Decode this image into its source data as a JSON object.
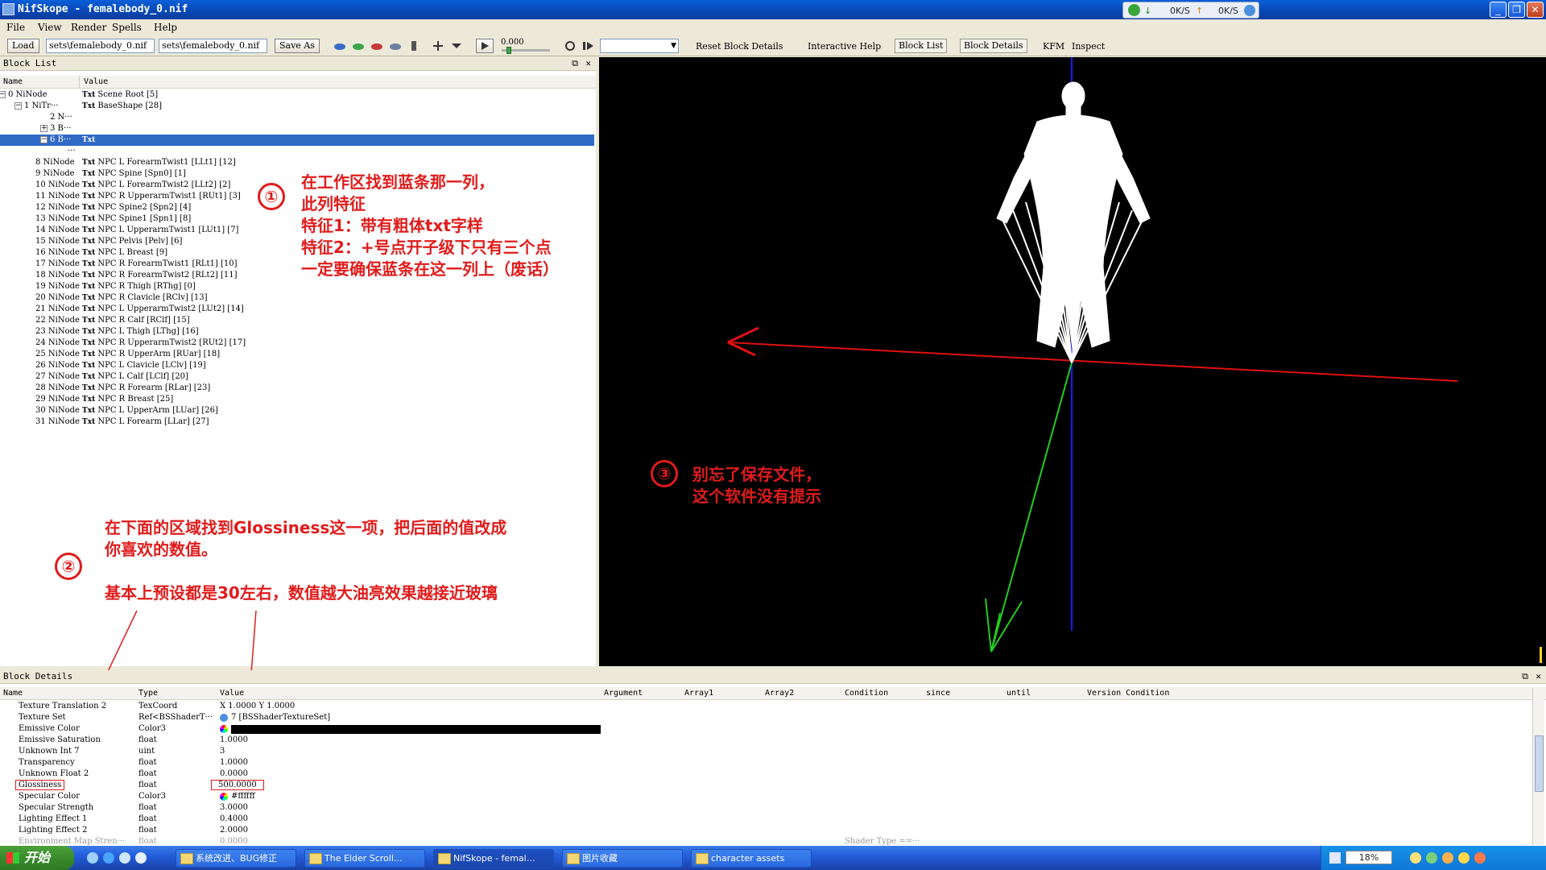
{
  "window": {
    "title": "NifSkope - femalebody_0.nif"
  },
  "netmeter": {
    "down": "0K/S",
    "up": "0K/S"
  },
  "menu": [
    "File",
    "View",
    "Render",
    "Spells",
    "Help"
  ],
  "toolbar": {
    "load": "Load",
    "path1": "sets\\femalebody_0.nif",
    "path2": "sets\\femalebody_0.nif",
    "save_as": "Save As",
    "time_value": "0.000",
    "reset_block_details": "Reset Block Details",
    "interactive_help": "Interactive Help",
    "block_list": "Block List",
    "block_details": "Block Details",
    "kfm": "KFM",
    "inspect": "Inspect"
  },
  "block_list": {
    "title": "Block List",
    "col_name": "Name",
    "col_value": "Value",
    "txt": "Txt",
    "rows": [
      {
        "name": "0 NiNode",
        "value": "Scene Root [5]"
      },
      {
        "name": "1 NiTr···",
        "value": "BaseShape [28]"
      },
      {
        "name": "2 N···",
        "value": ""
      },
      {
        "name": "3 B···",
        "value": ""
      },
      {
        "name": "6 B···",
        "value": ""
      },
      {
        "name": "···",
        "value": ""
      },
      {
        "name": "8 NiNode",
        "value": "NPC L ForearmTwist1 [LLt1] [12]"
      },
      {
        "name": "9 NiNode",
        "value": "NPC Spine [Spn0] [1]"
      },
      {
        "name": "10 NiNode",
        "value": "NPC L ForearmTwist2 [LLt2] [2]"
      },
      {
        "name": "11 NiNode",
        "value": "NPC R UpperarmTwist1 [RUt1] [3]"
      },
      {
        "name": "12 NiNode",
        "value": "NPC Spine2 [Spn2] [4]"
      },
      {
        "name": "13 NiNode",
        "value": "NPC Spine1 [Spn1] [8]"
      },
      {
        "name": "14 NiNode",
        "value": "NPC L UpperarmTwist1 [LUt1] [7]"
      },
      {
        "name": "15 NiNode",
        "value": "NPC Pelvis [Pelv] [6]"
      },
      {
        "name": "16 NiNode",
        "value": "NPC L Breast [9]"
      },
      {
        "name": "17 NiNode",
        "value": "NPC R ForearmTwist1 [RLt1] [10]"
      },
      {
        "name": "18 NiNode",
        "value": "NPC R ForearmTwist2 [RLt2] [11]"
      },
      {
        "name": "19 NiNode",
        "value": "NPC R Thigh [RThg] [0]"
      },
      {
        "name": "20 NiNode",
        "value": "NPC R Clavicle [RClv] [13]"
      },
      {
        "name": "21 NiNode",
        "value": "NPC L UpperarmTwist2 [LUt2] [14]"
      },
      {
        "name": "22 NiNode",
        "value": "NPC R Calf [RClf] [15]"
      },
      {
        "name": "23 NiNode",
        "value": "NPC L Thigh [LThg] [16]"
      },
      {
        "name": "24 NiNode",
        "value": "NPC R UpperarmTwist2 [RUt2] [17]"
      },
      {
        "name": "25 NiNode",
        "value": "NPC R UpperArm [RUar] [18]"
      },
      {
        "name": "26 NiNode",
        "value": "NPC L Clavicle [LClv] [19]"
      },
      {
        "name": "27 NiNode",
        "value": "NPC L Calf [LClf] [20]"
      },
      {
        "name": "28 NiNode",
        "value": "NPC R Forearm [RLar] [23]"
      },
      {
        "name": "29 NiNode",
        "value": "NPC R Breast [25]"
      },
      {
        "name": "30 NiNode",
        "value": "NPC L UpperArm [LUar] [26]"
      },
      {
        "name": "31 NiNode",
        "value": "NPC L Forearm [LLar] [27]"
      }
    ]
  },
  "annotations": {
    "n1": "①",
    "n2": "②",
    "n3": "③",
    "a1_l1": "在工作区找到蓝条那一列，",
    "a1_l2": "此列特征",
    "a1_l3": "特征1：带有粗体txt字样",
    "a1_l4": "特征2：+号点开子级下只有三个点",
    "a1_l5": "一定要确保蓝条在这一列上（废话）",
    "a2_l1": "在下面的区域找到Glossiness这一项，把后面的值改成",
    "a2_l2": "你喜欢的数值。",
    "a2_l3": "基本上预设都是30左右，数值越大油亮效果越接近玻璃",
    "a3_l1": "别忘了保存文件，",
    "a3_l2": "这个软件没有提示"
  },
  "block_details": {
    "title": "Block Details",
    "columns": [
      "Name",
      "Type",
      "Value",
      "Argument",
      "Array1",
      "Array2",
      "Condition",
      "since",
      "until",
      "Version Condition"
    ],
    "rows": [
      {
        "name": "Texture Translation 2",
        "type": "TexCoord",
        "value": "X 1.0000 Y 1.0000"
      },
      {
        "name": "Texture Set",
        "type": "Ref<BSShaderT···",
        "value": "7 [BSShaderTextureSet]"
      },
      {
        "name": "Emissive Color",
        "type": "Color3",
        "value": ""
      },
      {
        "name": "Emissive Saturation",
        "type": "float",
        "value": "1.0000"
      },
      {
        "name": "Unknown Int 7",
        "type": "uint",
        "value": "3"
      },
      {
        "name": "Transparency",
        "type": "float",
        "value": "1.0000"
      },
      {
        "name": "Unknown Float 2",
        "type": "float",
        "value": "0.0000"
      },
      {
        "name": "Glossiness",
        "type": "float",
        "value": "500.0000"
      },
      {
        "name": "Specular Color",
        "type": "Color3",
        "value": "#ffffff"
      },
      {
        "name": "Specular Strength",
        "type": "float",
        "value": "3.0000"
      },
      {
        "name": "Lighting Effect 1",
        "type": "float",
        "value": "0.4000"
      },
      {
        "name": "Lighting Effect 2",
        "type": "float",
        "value": "2.0000"
      },
      {
        "name": "Environment Map Stren···",
        "type": "float",
        "value": "0.0000",
        "condition": "Shader Type ==···"
      }
    ]
  },
  "taskbar": {
    "start": "开始",
    "tasks": [
      "系统改进、BUG修正",
      "The Elder Scroll…",
      "NifSkope - femal…",
      "图片收藏",
      "character assets"
    ],
    "battery": "18%"
  },
  "colors": {
    "annotation": "#e11b1b",
    "selection": "#316ac5",
    "axis_x": "#e01010",
    "axis_y": "#22cc22",
    "axis_z": "#1a1aff"
  }
}
